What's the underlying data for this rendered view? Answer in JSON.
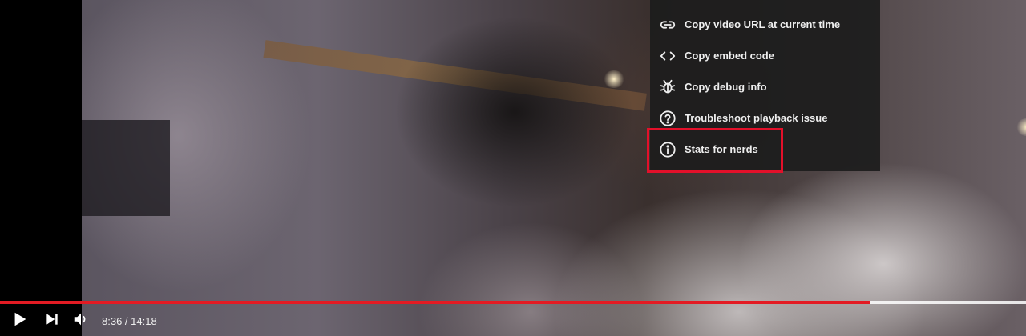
{
  "context_menu": {
    "items": [
      {
        "label": "Copy video URL at current time",
        "icon": "link-icon"
      },
      {
        "label": "Copy embed code",
        "icon": "code-icon"
      },
      {
        "label": "Copy debug info",
        "icon": "bug-icon"
      },
      {
        "label": "Troubleshoot playback issue",
        "icon": "question-circle-icon"
      },
      {
        "label": "Stats for nerds",
        "icon": "info-circle-icon",
        "highlighted": true
      }
    ]
  },
  "player": {
    "time_current": "8:36",
    "time_separator": " / ",
    "time_total": "14:18",
    "progress_fraction": 0.848,
    "controls": [
      "play-icon",
      "next-icon",
      "volume-icon"
    ]
  },
  "colors": {
    "progress_played": "#e31b23",
    "highlight_box": "#e3102a",
    "menu_bg": "#1c1c1c"
  }
}
